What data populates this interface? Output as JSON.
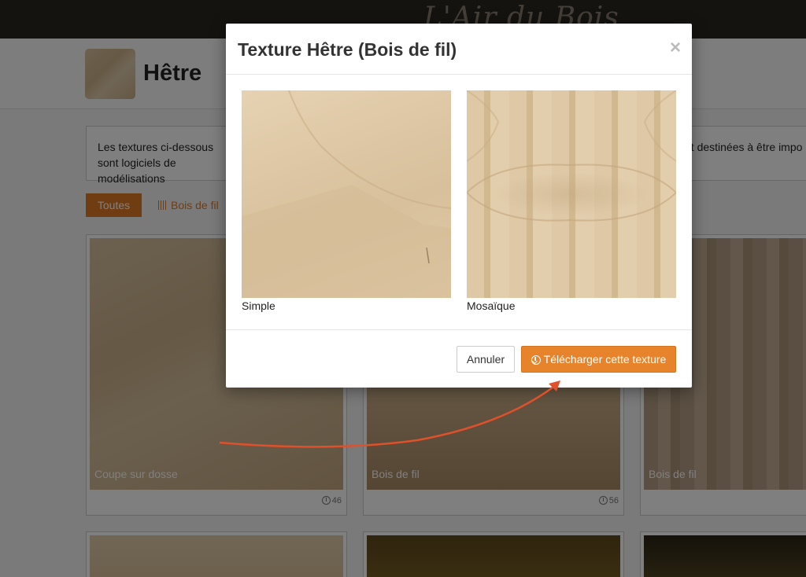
{
  "site": {
    "logo": "L'Air du Bois"
  },
  "header": {
    "title": "Hêtre"
  },
  "intro": {
    "left_text": "Les textures ci-dessous sont logiciels de modélisations",
    "right_text": "nt destinées à être impo"
  },
  "filters": {
    "all_label": "Toutes",
    "grain_label": "Bois de fil"
  },
  "cards": [
    {
      "caption": "Coupe sur dosse",
      "downloads": "46"
    },
    {
      "caption": "Bois de fil",
      "downloads": "56"
    },
    {
      "caption": "Bois de fil",
      "downloads": ""
    }
  ],
  "modal": {
    "title": "Texture Hêtre (Bois de fil)",
    "close_glyph": "×",
    "previews": [
      {
        "label": "Simple"
      },
      {
        "label": "Mosaïque"
      }
    ],
    "cancel_label": "Annuler",
    "download_label": "Télécharger cette texture"
  },
  "icons": {
    "close": "close-icon",
    "download": "download-icon",
    "grain": "grain-icon"
  },
  "colors": {
    "accent": "#e07b25",
    "topbar": "#2b2621",
    "annotation_arrow": "#e0502a"
  }
}
